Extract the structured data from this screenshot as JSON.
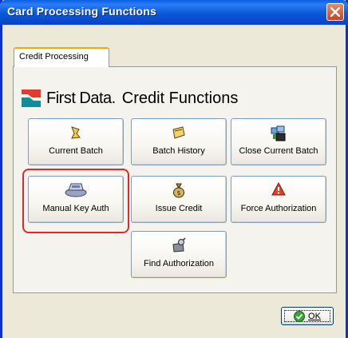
{
  "window": {
    "title": "Card Processing Functions"
  },
  "tab": {
    "label": "Credit Processing"
  },
  "brand": {
    "name": "First Data.",
    "subtitle": "Credit Functions"
  },
  "buttons": [
    {
      "label": "Current Batch",
      "icon": "batch-icon"
    },
    {
      "label": "Batch History",
      "icon": "history-icon"
    },
    {
      "label": "Close Current Batch",
      "icon": "close-batch-icon"
    },
    {
      "label": "Manual Key Auth",
      "icon": "card-reader-icon",
      "highlighted": true
    },
    {
      "label": "Issue Credit",
      "icon": "money-bag-icon"
    },
    {
      "label": "Force Authorization",
      "icon": "warning-icon"
    },
    {
      "label": "Find Authorization",
      "icon": "find-auth-icon"
    }
  ],
  "ok": {
    "label": "OK"
  },
  "colors": {
    "title_bar": "#0a58d8",
    "highlight_border": "#e12828",
    "brand_red": "#e23a2f",
    "brand_teal": "#0e8f98"
  }
}
